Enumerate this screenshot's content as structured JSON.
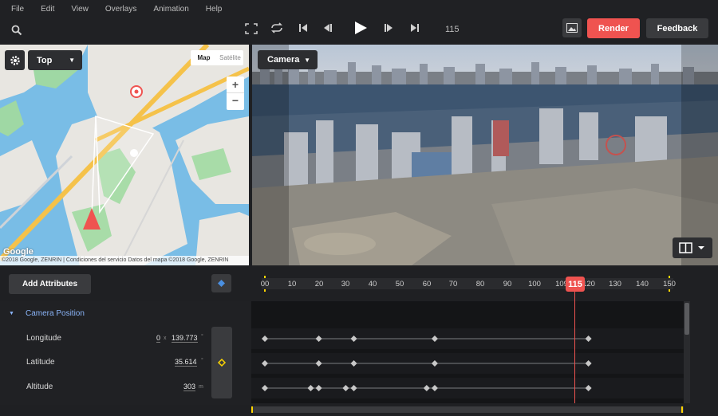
{
  "menu": [
    "File",
    "Edit",
    "View",
    "Overlays",
    "Animation",
    "Help"
  ],
  "toolbar": {
    "current_frame": "115",
    "render_label": "Render",
    "feedback_label": "Feedback"
  },
  "map": {
    "view_label": "Top",
    "type_map": "Map",
    "type_satellite": "Satélite",
    "zoom_in": "+",
    "zoom_out": "−",
    "logo": "Google",
    "copyright": "©2018 Google, ZENRIN  |  Condiciones del servicio  Datos del mapa ©2018 Google, ZENRIN"
  },
  "camera_view": {
    "label": "Camera"
  },
  "timeline": {
    "add_attributes_label": "Add Attributes",
    "ticks": [
      "00",
      "10",
      "20",
      "30",
      "40",
      "50",
      "60",
      "70",
      "80",
      "90",
      "100",
      "109",
      "120",
      "130",
      "140",
      "150"
    ],
    "current": "115",
    "max_frame": 150
  },
  "section": {
    "title": "Camera Position",
    "rows": [
      {
        "name": "Longitude",
        "value_a": "0",
        "value_b": "139.773",
        "unit": "°"
      },
      {
        "name": "Latitude",
        "value": "35.614",
        "unit": "°"
      },
      {
        "name": "Altitude",
        "value": "303",
        "unit": "m"
      }
    ]
  },
  "keyframes": {
    "longitude": [
      0,
      20,
      33,
      63,
      120
    ],
    "latitude": [
      0,
      20,
      33,
      63,
      120
    ],
    "altitude": [
      0,
      17,
      20,
      30,
      33,
      60,
      63,
      120
    ]
  },
  "colors": {
    "accent": "#ef5350",
    "link": "#8ab4f8",
    "keyframe_highlight": "#ffd600"
  }
}
